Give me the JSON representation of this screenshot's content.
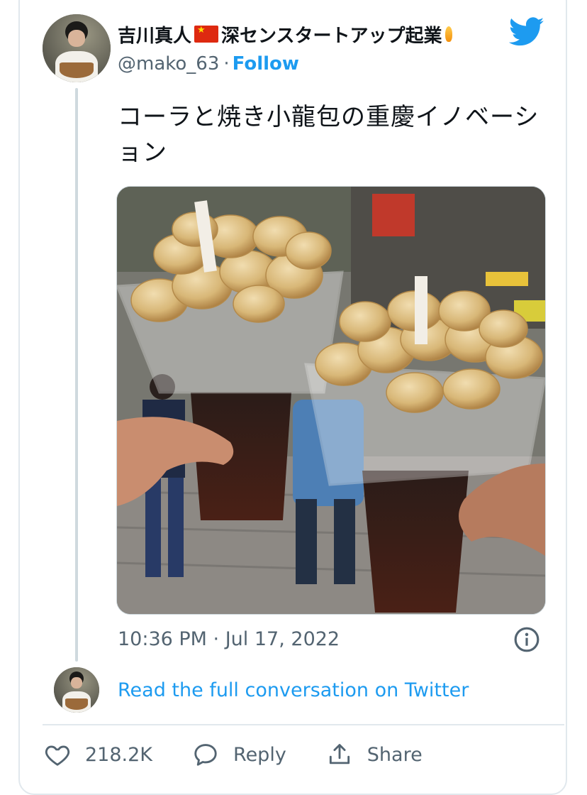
{
  "author": {
    "display_name_prefix": "吉川真人",
    "display_name_suffix": "深センスタートアップ起業",
    "handle": "@mako_63",
    "separator": "·",
    "follow_label": "Follow"
  },
  "tweet": {
    "text": "コーラと焼き小龍包の重慶イノベーション",
    "timestamp": "10:36 PM · Jul 17, 2022"
  },
  "conversation": {
    "link_label": "Read the full conversation on Twitter"
  },
  "actions": {
    "like_count": "218.2K",
    "reply_label": "Reply",
    "share_label": "Share"
  },
  "icons": {
    "bird": "twitter-bird-icon",
    "info": "info-icon",
    "like": "heart-icon",
    "reply": "speech-bubble-icon",
    "share": "share-icon"
  },
  "colors": {
    "accent": "#1d9bf0",
    "secondary_text": "#536471",
    "border": "#e1e8ed",
    "flag_red": "#de2910"
  }
}
